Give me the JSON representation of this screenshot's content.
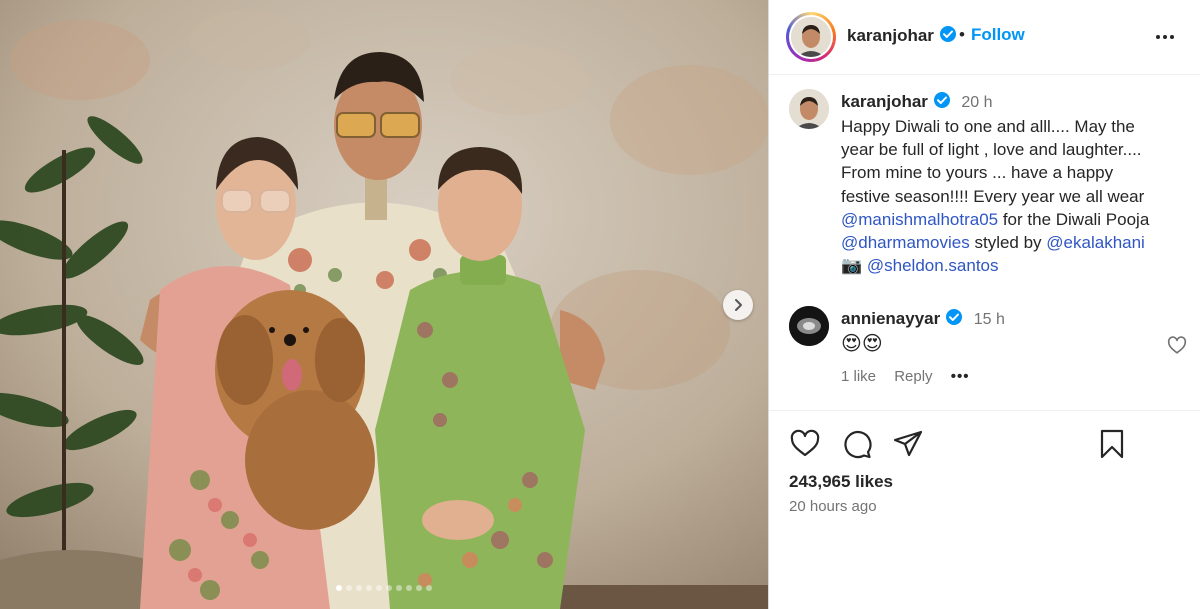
{
  "post": {
    "media": {
      "alt_icon": "photo",
      "next_icon": "chevron-right-icon",
      "carousel_count": 10,
      "carousel_active": 0
    },
    "header": {
      "username": "karanjohar",
      "verified": true,
      "separator": "•",
      "follow_label": "Follow",
      "more_icon": "more-horizontal-icon"
    },
    "caption": {
      "username": "karanjohar",
      "time": "20 h",
      "lines": [
        [
          {
            "t": "Happy Diwali to one and alll.... May the"
          }
        ],
        [
          {
            "t": "year be full of light , love and laughter...."
          }
        ],
        [
          {
            "t": "From mine to yours ... have a happy"
          }
        ],
        [
          {
            "t": "festive season!!!! Every year we all wear"
          }
        ],
        [
          {
            "m": "@manishmalhotra05"
          },
          {
            "t": " for the Diwali Pooja"
          }
        ],
        [
          {
            "m": "@dharmamovies"
          },
          {
            "t": " styled by "
          },
          {
            "m": "@ekalakhani"
          }
        ],
        [
          {
            "t": "📷 "
          },
          {
            "m": "@sheldon.santos"
          }
        ]
      ]
    },
    "comment": {
      "username": "annienayyar",
      "time": "15 h",
      "text": "😍😍",
      "likes_label": "1 like",
      "reply_label": "Reply",
      "more_label": "•••"
    },
    "actions": {
      "like_icon": "heart-icon",
      "comment_icon": "comment-icon",
      "share_icon": "send-icon",
      "save_icon": "bookmark-icon"
    },
    "likes_text": "243,965 likes",
    "posted_ago": "20 hours ago"
  },
  "colors": {
    "accent_blue": "#0095f6",
    "mention": "#2f56c4",
    "text": "#262626",
    "muted": "#737373",
    "verified": "#0095f6"
  }
}
